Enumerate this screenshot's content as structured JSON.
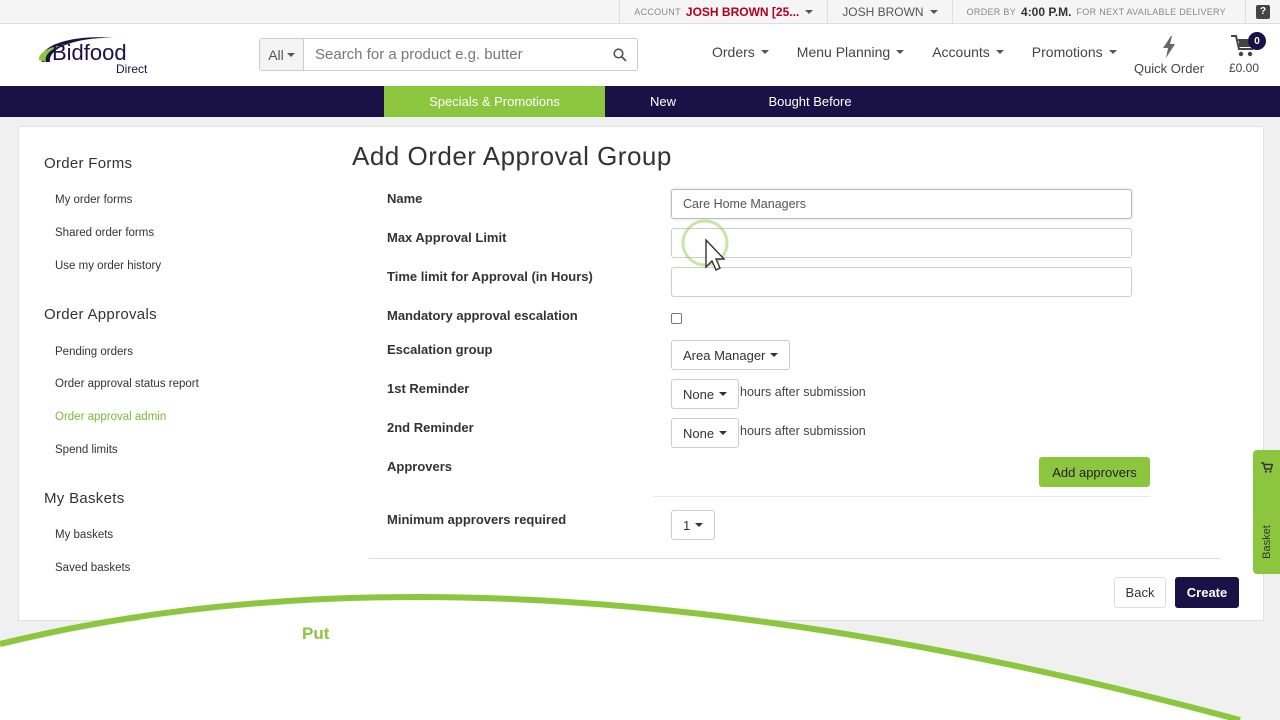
{
  "topbar": {
    "account_small": "ACCOUNT",
    "account_name": "JOSH BROWN [25...",
    "user": "JOSH BROWN",
    "order_small": "ORDER BY",
    "order_time": "4:00 P.M.",
    "order_suffix": "FOR NEXT AVAILABLE DELIVERY",
    "help": "?"
  },
  "header": {
    "logo_text": "Bidfood",
    "logo_sub": "Direct",
    "search_scope": "All",
    "search_placeholder": "Search for a product e.g. butter",
    "nav": [
      "Orders",
      "Menu Planning",
      "Accounts",
      "Promotions"
    ],
    "quick_order": "Quick Order",
    "cart_total": "£0.00",
    "cart_count": "0"
  },
  "catbar": {
    "tabs": [
      "Specials & Promotions",
      "New",
      "Bought Before"
    ]
  },
  "sidebar": {
    "section1": "Order Forms",
    "section1_items": [
      "My order forms",
      "Shared order forms",
      "Use my order history"
    ],
    "section2": "Order Approvals",
    "section2_items": [
      "Pending orders",
      "Order approval status report",
      "Order approval admin",
      "Spend limits"
    ],
    "section3": "My Baskets",
    "section3_items": [
      "My baskets",
      "Saved baskets"
    ]
  },
  "form": {
    "title": "Add Order Approval Group",
    "name_label": "Name",
    "name_value": "Care Home Managers",
    "max_label": "Max Approval Limit",
    "max_value": "",
    "time_label": "Time limit for Approval (in Hours)",
    "time_value": "",
    "mandatory_label": "Mandatory approval escalation",
    "escalation_label": "Escalation group",
    "escalation_value": "Area Manager",
    "reminder1_label": "1st Reminder",
    "reminder1_value": "None",
    "reminder2_label": "2nd Reminder",
    "reminder2_value": "None",
    "reminder_hint": "hours after submission",
    "approvers_label": "Approvers",
    "add_approvers": "Add approvers",
    "min_label": "Minimum approvers required",
    "min_value": "1",
    "back": "Back",
    "create": "Create"
  },
  "basket_tab": "Basket",
  "overlay_text": "Put",
  "colors": {
    "brand_navy": "#1a1147",
    "brand_green": "#8cc63f",
    "account_red": "#b00020"
  }
}
